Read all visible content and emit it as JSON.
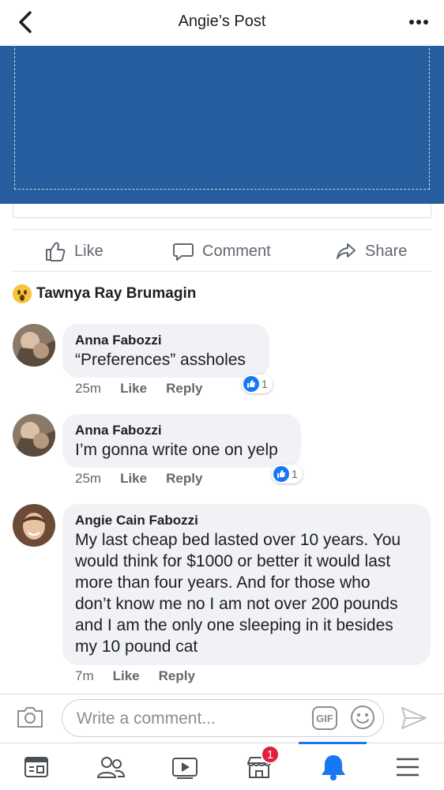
{
  "header": {
    "title": "Angie’s Post"
  },
  "actions": {
    "like": "Like",
    "comment": "Comment",
    "share": "Share"
  },
  "reactor": {
    "name": "Tawnya Ray Brumagin"
  },
  "comments": [
    {
      "author": "Anna Fabozzi",
      "text": "“Preferences” assholes",
      "time": "25m",
      "like": "Like",
      "reply": "Reply",
      "reactions": "1"
    },
    {
      "author": "Anna Fabozzi",
      "text": "I’m gonna write one on yelp",
      "time": "25m",
      "like": "Like",
      "reply": "Reply",
      "reactions": "1"
    },
    {
      "author": "Angie Cain Fabozzi",
      "lines": [
        "My last cheap bed lasted over 10 years. You",
        "would think for $1000 or better it would last",
        "more than four years. And for those who",
        "don’t know me no I am not over 200 pounds",
        "and I am the only one sleeping in it besides",
        "my 10 pound cat"
      ],
      "time": "7m",
      "like": "Like",
      "reply": "Reply"
    }
  ],
  "composer": {
    "placeholder": "Write a comment...",
    "gif": "GIF"
  },
  "tabbar": {
    "marketplace_badge": "1"
  },
  "colors": {
    "banner": "#265d9e",
    "accent": "#1877f2",
    "badge": "#e41e3f"
  }
}
